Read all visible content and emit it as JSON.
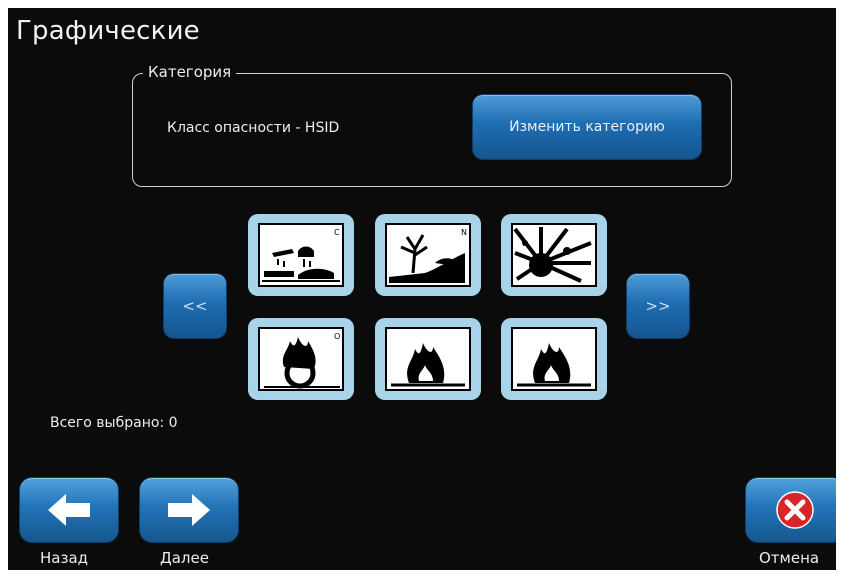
{
  "header": {
    "title": "Графические"
  },
  "category": {
    "legend": "Категория",
    "value": "Класс опасности - HSID",
    "change_label": "Изменить категорию"
  },
  "pager": {
    "prev_label": "<<",
    "next_label": ">>"
  },
  "symbols": [
    {
      "icon": "corrosive-icon",
      "corner": "C"
    },
    {
      "icon": "environment-hazard-icon",
      "corner": "N"
    },
    {
      "icon": "explosive-icon",
      "corner": ""
    },
    {
      "icon": "oxidizer-icon",
      "corner": "O"
    },
    {
      "icon": "flammable-icon",
      "corner": ""
    },
    {
      "icon": "flammable-icon",
      "corner": ""
    }
  ],
  "status": {
    "total_selected": "Всего выбрано: 0"
  },
  "nav": {
    "back_label": "Назад",
    "next_label": "Далее",
    "cancel_label": "Отмена"
  },
  "colors": {
    "accent": "#2274b8",
    "tile": "#a8d4ea",
    "cancel": "#d9252a"
  }
}
